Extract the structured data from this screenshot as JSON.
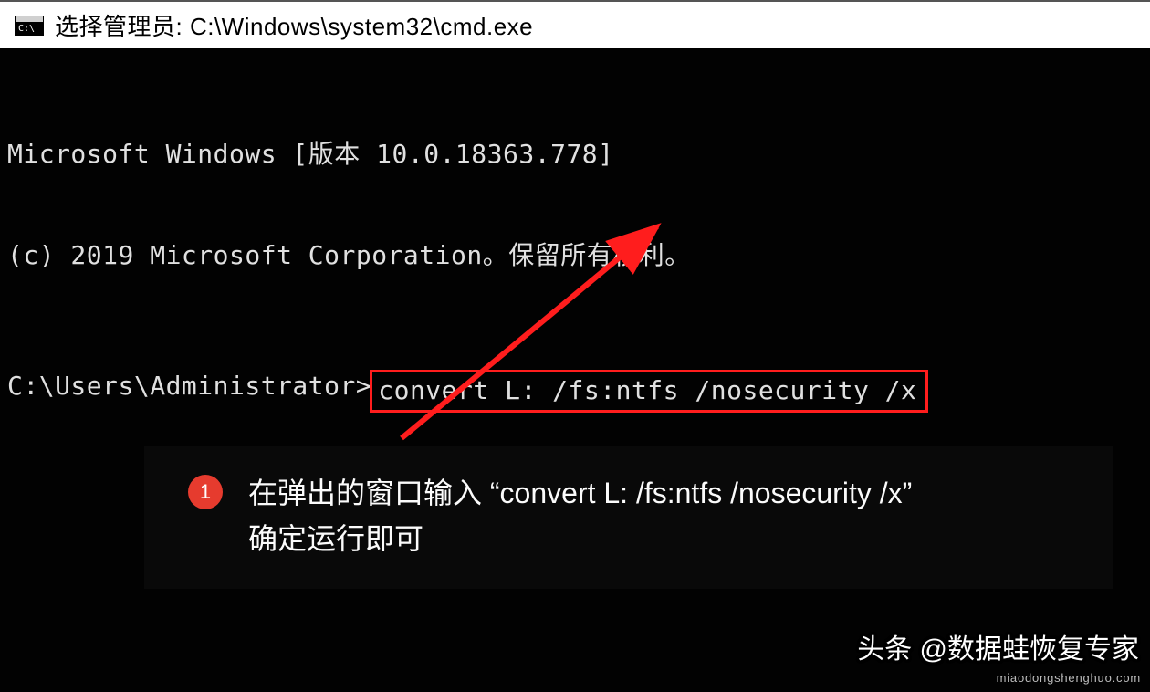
{
  "titlebar": {
    "title": "选择管理员: C:\\Windows\\system32\\cmd.exe"
  },
  "terminal": {
    "line1": "Microsoft Windows [版本 10.0.18363.778]",
    "line2": "(c) 2019 Microsoft Corporation。保留所有权利。",
    "prompt": "C:\\Users\\Administrator>",
    "command": "convert L: /fs:ntfs /nosecurity /x"
  },
  "annotation": {
    "step": "1",
    "text_line1": "在弹出的窗口输入 “convert L: /fs:ntfs /nosecurity /x”",
    "text_line2": "确定运行即可"
  },
  "watermark": {
    "main": "头条 @数据蛙恢复专家",
    "sub": "miaodongshenghuo.com"
  },
  "colors": {
    "highlight_border": "#ff1d1d",
    "step_badge": "#e63b2e"
  }
}
